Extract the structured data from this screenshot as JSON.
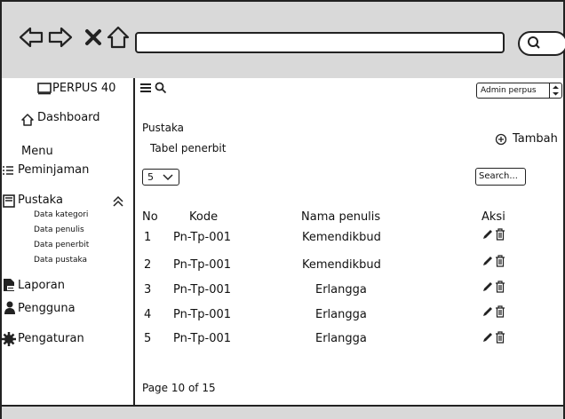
{
  "app": {
    "title": "PERPUS 40"
  },
  "sidebar": {
    "dashboard": "Dashboard",
    "menu_heading": "Menu",
    "items": [
      {
        "label": "Peminjaman",
        "icon": "list-icon"
      },
      {
        "label": "Pustaka",
        "icon": "book-icon",
        "expanded": true,
        "subitems": [
          "Data kategori",
          "Data penulis",
          "Data penerbit",
          "Data pustaka"
        ]
      },
      {
        "label": "Laporan",
        "icon": "pdf-icon"
      },
      {
        "label": "Pengguna",
        "icon": "user-icon"
      },
      {
        "label": "Pengaturan",
        "icon": "gear-icon"
      }
    ]
  },
  "header": {
    "user_select": "Admin perpus"
  },
  "content": {
    "breadcrumb": "Pustaka",
    "table_title": "Tabel penerbit",
    "add_label": "Tambah",
    "page_size": "5",
    "search_placeholder": "Search..."
  },
  "table": {
    "headers": [
      "No",
      "Kode",
      "Nama penulis",
      "Aksi"
    ],
    "rows": [
      {
        "no": "1",
        "kode": "Pn-Tp-001",
        "nama": "Kemendikbud"
      },
      {
        "no": "2",
        "kode": "Pn-Tp-001",
        "nama": "Kemendikbud"
      },
      {
        "no": "3",
        "kode": "Pn-Tp-001",
        "nama": "Erlangga"
      },
      {
        "no": "4",
        "kode": "Pn-Tp-001",
        "nama": "Erlangga"
      },
      {
        "no": "5",
        "kode": "Pn-Tp-001",
        "nama": "Erlangga"
      }
    ]
  },
  "pagination": "Page 10 of 15"
}
